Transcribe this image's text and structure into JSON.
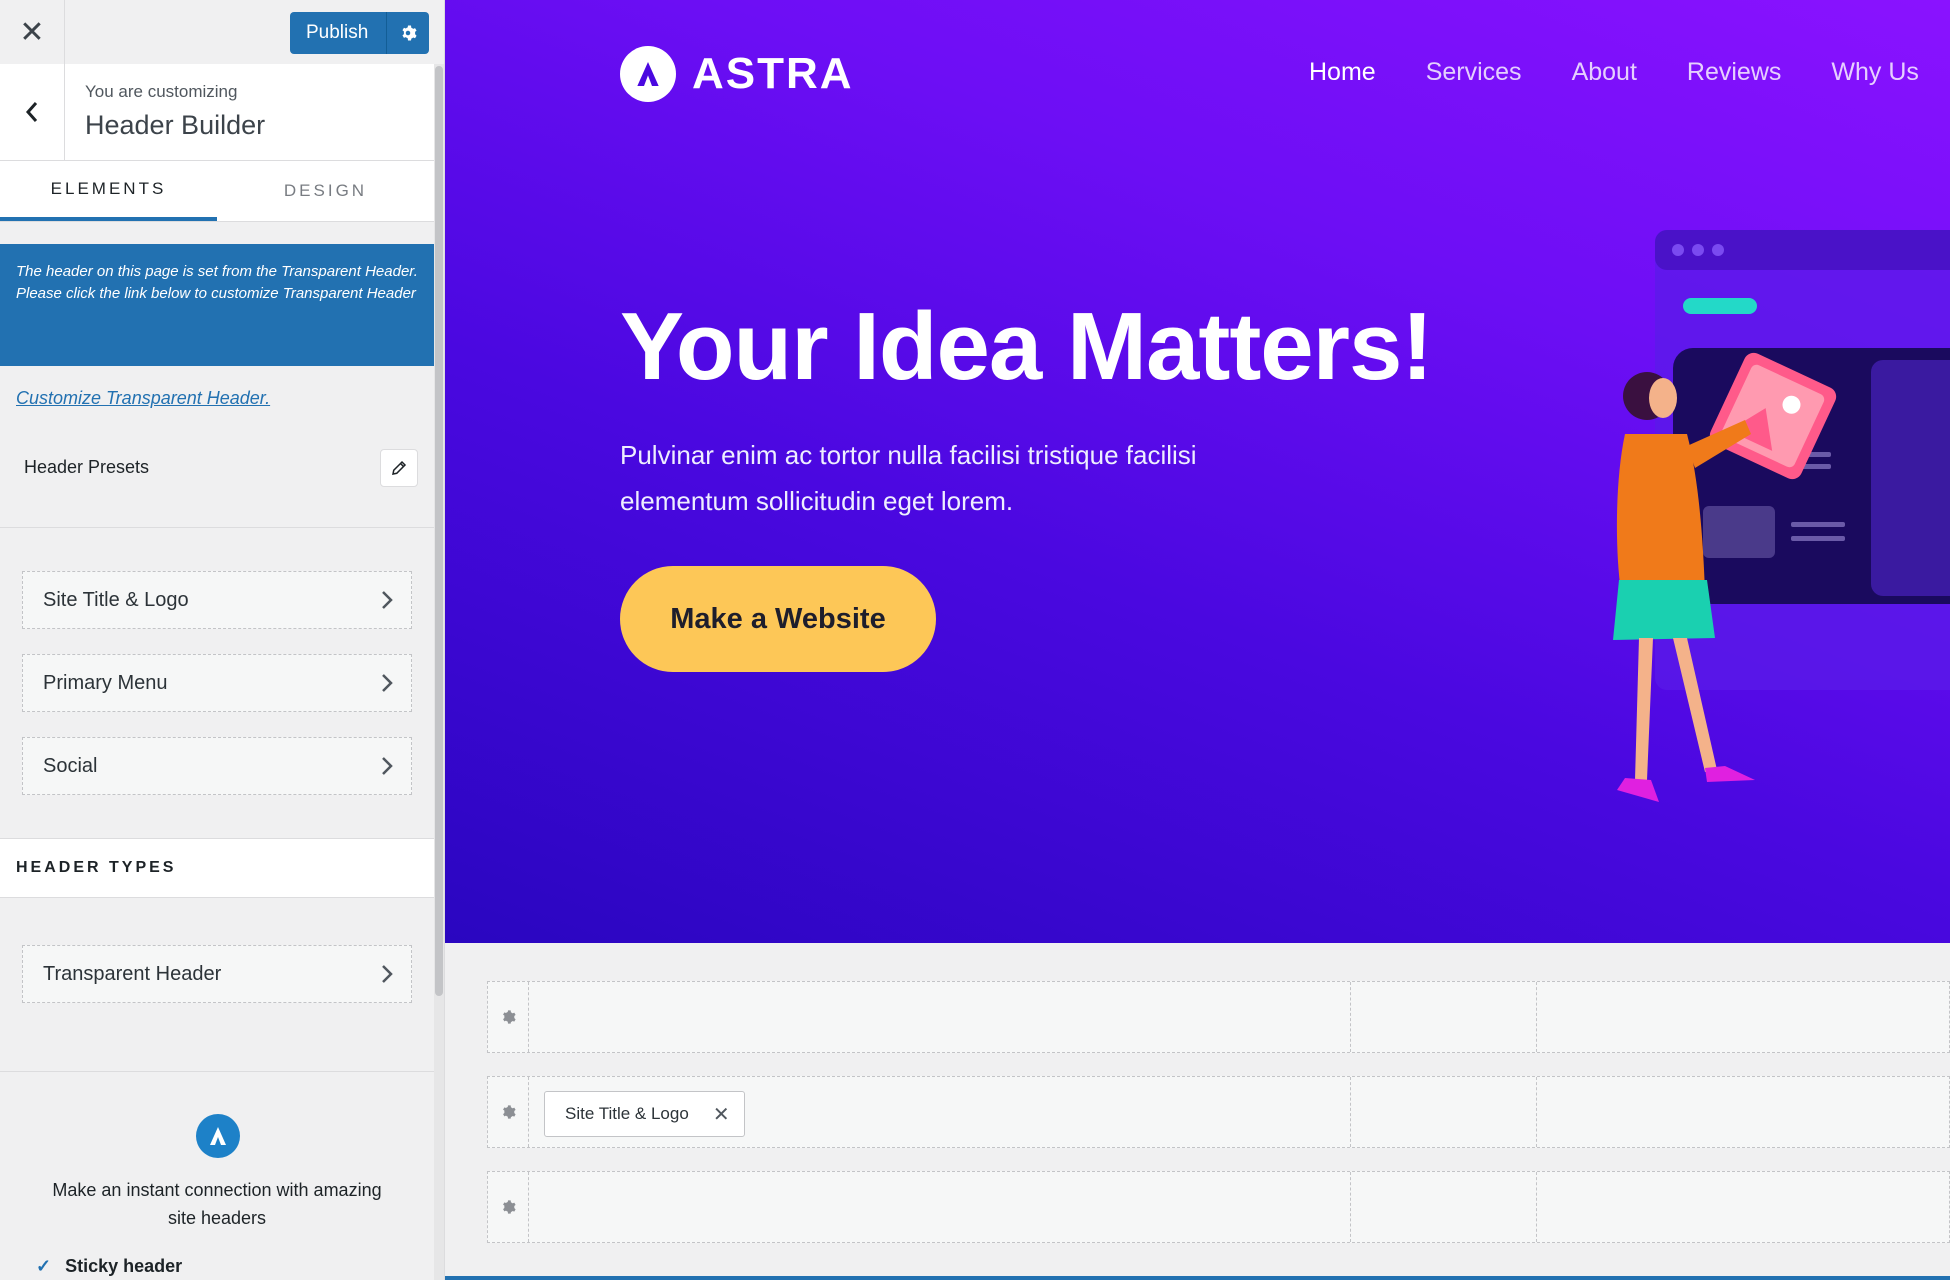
{
  "sidebar": {
    "publish_label": "Publish",
    "customizing_label": "You are customizing",
    "panel_title": "Header Builder",
    "tabs": [
      {
        "label": "ELEMENTS",
        "active": true
      },
      {
        "label": "DESIGN",
        "active": false
      }
    ],
    "notice": {
      "line1": "The header on this page is set from the Transparent Header.",
      "line2": "Please click the link below to customize Transparent Header"
    },
    "customize_link": "Customize Transparent Header.",
    "presets_label": "Header Presets",
    "elements": [
      {
        "label": "Site Title & Logo"
      },
      {
        "label": "Primary Menu"
      },
      {
        "label": "Social"
      }
    ],
    "header_types_label": "HEADER TYPES",
    "header_types": [
      {
        "label": "Transparent Header"
      }
    ],
    "promo": {
      "text": "Make an instant connection with amazing site headers",
      "features": [
        {
          "label": "Sticky header"
        }
      ]
    }
  },
  "preview": {
    "logo_text": "ASTRA",
    "nav": [
      {
        "label": "Home",
        "active": true
      },
      {
        "label": "Services",
        "active": false
      },
      {
        "label": "About",
        "active": false
      },
      {
        "label": "Reviews",
        "active": false
      },
      {
        "label": "Why Us",
        "active": false
      }
    ],
    "hero_title": "Your Idea Matters!",
    "hero_subtitle": "Pulvinar enim ac tortor nulla facilisi tristique facilisi elementum sollicitudin eget lorem.",
    "cta_label": "Make a Website"
  },
  "builder": {
    "rows": [
      {
        "name": "above-header",
        "items": []
      },
      {
        "name": "primary-header",
        "items": [
          {
            "label": "Site Title & Logo"
          }
        ]
      },
      {
        "name": "below-header",
        "items": []
      }
    ]
  },
  "colors": {
    "accent": "#2271b1",
    "cta": "#fdc757",
    "hero_gradient_start": "#2a06c0",
    "hero_gradient_end": "#8a12ff"
  },
  "icons": [
    "close-icon",
    "gear-icon",
    "chevron-left-icon",
    "pencil-icon",
    "chevron-right-icon",
    "astra-logo-icon",
    "check-icon"
  ]
}
